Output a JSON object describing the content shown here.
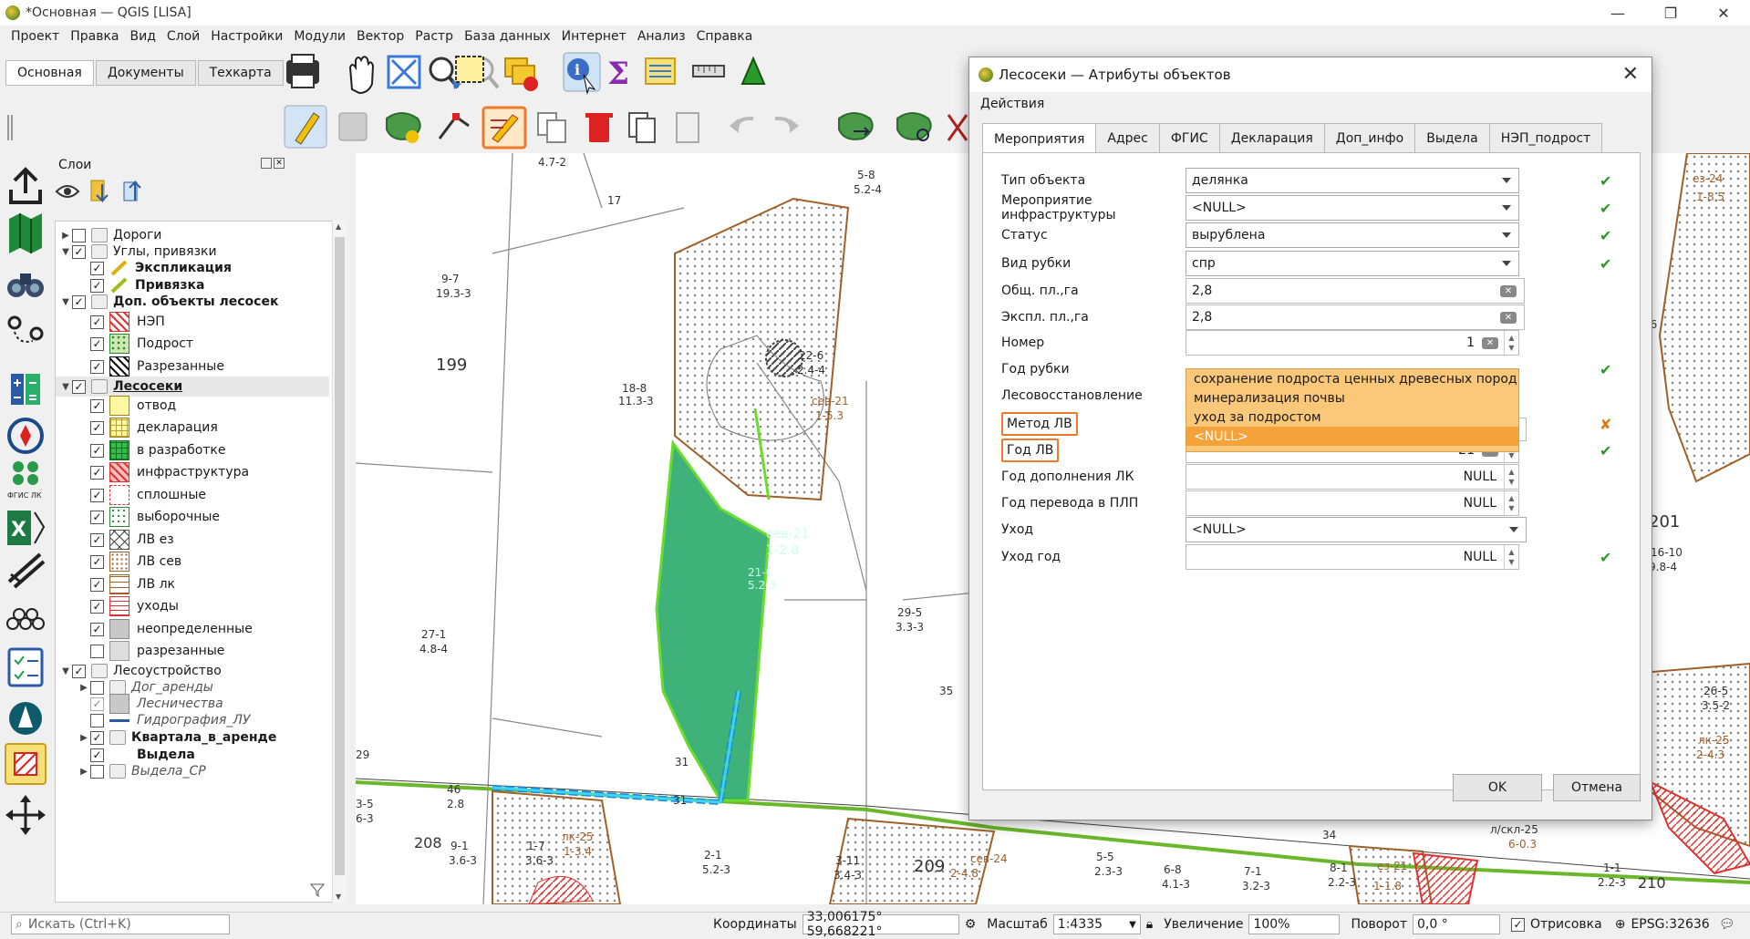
{
  "window": {
    "title": "*Основная — QGIS [LISA]",
    "min": "—",
    "max": "❐",
    "close": "✕"
  },
  "menu": [
    "Проект",
    "Правка",
    "Вид",
    "Слой",
    "Настройки",
    "Модули",
    "Вектор",
    "Растр",
    "База данных",
    "Интернет",
    "Анализ",
    "Справка"
  ],
  "tabs": [
    "Основная",
    "Документы",
    "Техкарта"
  ],
  "layers_panel": {
    "title": "Слои",
    "items": [
      {
        "label": "Дороги",
        "indent": 0,
        "checked": false,
        "expand": "▶",
        "kind": "group"
      },
      {
        "label": "Углы, привязки",
        "indent": 0,
        "checked": true,
        "expand": "▼",
        "kind": "group"
      },
      {
        "label": "Экспликация",
        "indent": 1,
        "checked": true,
        "kind": "line",
        "bold": true
      },
      {
        "label": "Привязка",
        "indent": 1,
        "checked": true,
        "kind": "line",
        "bold": true
      },
      {
        "label": "Доп. объекты лесосек",
        "indent": 0,
        "checked": true,
        "expand": "▼",
        "kind": "group",
        "bold": true
      },
      {
        "label": "НЭП",
        "indent": 1,
        "checked": true,
        "kind": "hatch-red"
      },
      {
        "label": "Подрост",
        "indent": 1,
        "checked": true,
        "kind": "dots-green"
      },
      {
        "label": "Разрезанные",
        "indent": 1,
        "checked": true,
        "kind": "hatch-black"
      },
      {
        "label": "Лесосеки",
        "indent": 0,
        "checked": true,
        "expand": "▼",
        "kind": "group",
        "bold": true,
        "selected": true
      },
      {
        "label": "отвод",
        "indent": 1,
        "checked": true,
        "kind": "yellow"
      },
      {
        "label": "декларация",
        "indent": 1,
        "checked": true,
        "kind": "grid-yellow"
      },
      {
        "label": "в разработке",
        "indent": 1,
        "checked": true,
        "kind": "grid-green"
      },
      {
        "label": "инфраструктура",
        "indent": 1,
        "checked": true,
        "kind": "hatch-red2"
      },
      {
        "label": "сплошные",
        "indent": 1,
        "checked": true,
        "kind": "corners-red"
      },
      {
        "label": "выборочные",
        "indent": 1,
        "checked": true,
        "kind": "dots-green2"
      },
      {
        "label": "ЛВ ез",
        "indent": 1,
        "checked": true,
        "kind": "cross"
      },
      {
        "label": "ЛВ сев",
        "indent": 1,
        "checked": true,
        "kind": "dots-brown"
      },
      {
        "label": "ЛВ лк",
        "indent": 1,
        "checked": true,
        "kind": "wave"
      },
      {
        "label": "уходы",
        "indent": 1,
        "checked": true,
        "kind": "lines-red"
      },
      {
        "label": "неопределенные",
        "indent": 1,
        "checked": true,
        "kind": "grey"
      },
      {
        "label": "разрезанные",
        "indent": 1,
        "checked": false,
        "kind": "lightgrey"
      },
      {
        "label": "Лесоустройство",
        "indent": 0,
        "checked": true,
        "expand": "▼",
        "kind": "group"
      },
      {
        "label": "Дог_аренды",
        "indent": 1,
        "checked": false,
        "expand": "▶",
        "kind": "group",
        "italic": true
      },
      {
        "label": "Лесничества",
        "indent": 1,
        "checked": true,
        "kind": "grey",
        "italic": true,
        "dim": true
      },
      {
        "label": "Гидрография_ЛУ",
        "indent": 1,
        "checked": false,
        "kind": "blueline",
        "italic": true
      },
      {
        "label": "Квартала_в_аренде",
        "indent": 1,
        "checked": true,
        "expand": "▶",
        "kind": "group",
        "bold": true
      },
      {
        "label": "Выдела",
        "indent": 1,
        "checked": true,
        "kind": "white",
        "bold": true
      },
      {
        "label": "Выдела_СР",
        "indent": 1,
        "checked": false,
        "expand": "▶",
        "kind": "group",
        "italic": true
      }
    ]
  },
  "dialog": {
    "title": "Лесосеки — Атрибуты объектов",
    "menu": "Действия",
    "tabs": [
      "Мероприятия",
      "Адрес",
      "ФГИС",
      "Декларация",
      "Доп_инфо",
      "Выдела",
      "НЭП_подрост"
    ],
    "fields": [
      {
        "label": "Тип объекта",
        "value": "делянка",
        "type": "combo",
        "status": "ok"
      },
      {
        "label": "Мероприятие инфраструктуры",
        "value": "<NULL>",
        "type": "combo",
        "status": "ok"
      },
      {
        "label": "Статус",
        "value": "вырублена",
        "type": "combo",
        "status": "ok"
      },
      {
        "label": "Вид рубки",
        "value": "спр",
        "type": "combo",
        "status": "ok"
      },
      {
        "label": "Общ. пл.,га",
        "value": "2,8",
        "type": "text",
        "status": ""
      },
      {
        "label": "Экспл. пл.,га",
        "value": "2,8",
        "type": "text",
        "status": ""
      },
      {
        "label": "Номер",
        "value": "1",
        "type": "spin",
        "status": ""
      },
      {
        "label": "Год рубки",
        "value": "",
        "type": "hidden",
        "status": "ok"
      },
      {
        "label": "Лесовосстановление",
        "value": "",
        "type": "hidden",
        "status": ""
      },
      {
        "label": "Метод ЛВ",
        "value": "<NULL>",
        "type": "hidden",
        "status": "warn",
        "highlight": true
      },
      {
        "label": "Год ЛВ",
        "value": "21",
        "type": "spin",
        "status": "ok",
        "highlight": true
      },
      {
        "label": "Год дополнения ЛК",
        "value": "NULL",
        "type": "spin2",
        "status": ""
      },
      {
        "label": "Год перевода в ПЛП",
        "value": "NULL",
        "type": "spin2",
        "status": ""
      },
      {
        "label": "Уход",
        "value": "<NULL>",
        "type": "combo",
        "status": ""
      },
      {
        "label": "Уход год",
        "value": "NULL",
        "type": "spin2",
        "status": "ok"
      }
    ],
    "dropdown": [
      "сохранение подроста ценных древесных пород",
      "минерализация почвы",
      "уход за подростом",
      "<NULL>"
    ],
    "ok": "OK",
    "cancel": "Отмена"
  },
  "map_labels": [
    {
      "t": "4.7-2"
    },
    {
      "t": "17"
    },
    {
      "t": "9-7"
    },
    {
      "t": "19.3-3"
    },
    {
      "t": "199"
    },
    {
      "t": "18-8"
    },
    {
      "t": "11.3-3"
    },
    {
      "t": "5-8"
    },
    {
      "t": "5.2-4"
    },
    {
      "t": "22-6"
    },
    {
      "t": "2.4-4"
    },
    {
      "t": "сев-21"
    },
    {
      "t": "1-5.3"
    },
    {
      "t": "сев-21"
    },
    {
      "t": "1-2.8"
    },
    {
      "t": "21-6"
    },
    {
      "t": "5.2-3"
    },
    {
      "t": "27-1"
    },
    {
      "t": "4.8-4"
    },
    {
      "t": "29-5"
    },
    {
      "t": "3.3-3"
    },
    {
      "t": "35"
    },
    {
      "t": "31"
    },
    {
      "t": "31"
    },
    {
      "t": "46"
    },
    {
      "t": "2.8"
    },
    {
      "t": "208"
    },
    {
      "t": "9-1"
    },
    {
      "t": "3.6-3"
    },
    {
      "t": "1-7"
    },
    {
      "t": "3.6-3"
    },
    {
      "t": "лк-25"
    },
    {
      "t": "1-3.4"
    },
    {
      "t": "2-1"
    },
    {
      "t": "5.2-3"
    },
    {
      "t": "3-11"
    },
    {
      "t": "3.4-3"
    },
    {
      "t": "209"
    },
    {
      "t": "сев-24"
    },
    {
      "t": "2-4.8"
    },
    {
      "t": "5-5"
    },
    {
      "t": "2.3-3"
    },
    {
      "t": "6-8"
    },
    {
      "t": "4.1-3"
    },
    {
      "t": "7-1"
    },
    {
      "t": "3.2-3"
    },
    {
      "t": "8-1"
    },
    {
      "t": "2.2-3"
    },
    {
      "t": "34"
    },
    {
      "t": "ез-21"
    },
    {
      "t": "1-1.8"
    },
    {
      "t": "л/скл-25"
    },
    {
      "t": "6-0.3"
    },
    {
      "t": "1-1"
    },
    {
      "t": "2.2-3"
    },
    {
      "t": "210"
    },
    {
      "t": "201"
    },
    {
      "t": "16-10"
    },
    {
      "t": "9.8-4"
    },
    {
      "t": "ез-24"
    },
    {
      "t": "1-8.5"
    },
    {
      "t": "36"
    },
    {
      "t": "26-5"
    },
    {
      "t": "3.5-2"
    },
    {
      "t": "лк-25"
    },
    {
      "t": "2-4.3"
    },
    {
      "t": "3-5"
    },
    {
      "t": "6-3"
    },
    {
      "t": "29"
    }
  ],
  "statusbar": {
    "search_placeholder": "Искать (Ctrl+K)",
    "coords_label": "Координаты",
    "coords": "33,006175°  59,668221°",
    "scale_label": "Масштаб",
    "scale": "1:4335",
    "zoom_label": "Увеличение",
    "zoom": "100%",
    "rotation_label": "Поворот",
    "rotation": "0,0 °",
    "render_label": "Отрисовка",
    "crs": "EPSG:32636"
  }
}
